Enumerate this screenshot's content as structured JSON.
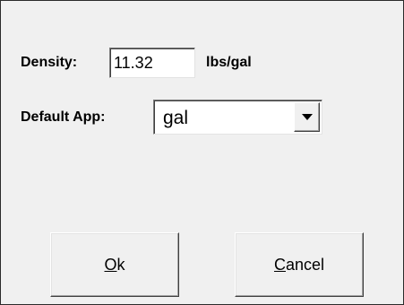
{
  "form": {
    "density_label": "Density:",
    "density_value": "11.32",
    "density_unit": "lbs/gal",
    "default_app_label": "Default App:",
    "default_app_selected": "gal"
  },
  "buttons": {
    "ok_accel": "O",
    "ok_rest": "k",
    "cancel_accel": "C",
    "cancel_rest": "ancel"
  },
  "icons": {
    "combo_arrow": "chevron-down-icon"
  }
}
